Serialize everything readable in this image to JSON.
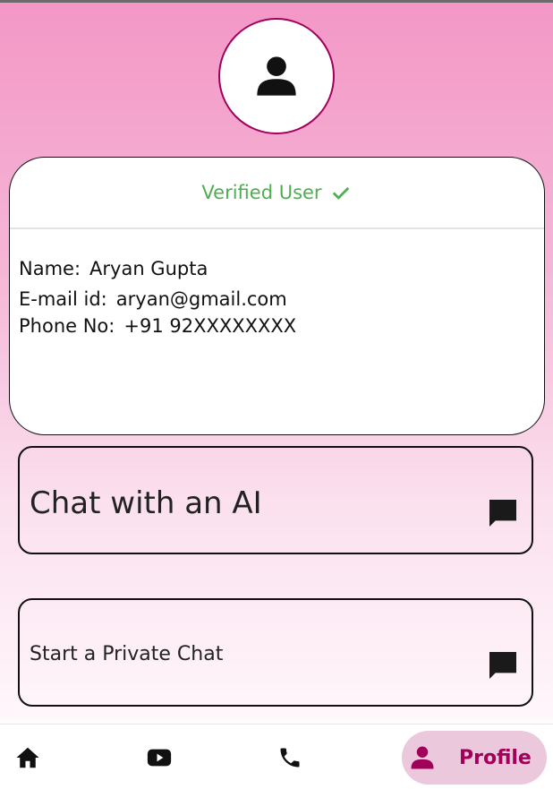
{
  "profile": {
    "avatar_icon": "person-icon",
    "verified_label": "Verified User",
    "verified_icon": "check-icon",
    "name_label": "Name:",
    "name_value": "Aryan Gupta",
    "email_label": "E-mail id:",
    "email_value": "aryan@gmail.com",
    "phone_label": "Phone No:",
    "phone_value": "+91 92XXXXXXXX"
  },
  "actions": {
    "ai_chat_label": "Chat with an AI",
    "private_chat_label": "Start a Private Chat",
    "chat_icon": "chat-bubble-icon"
  },
  "bottom_nav": {
    "items": [
      {
        "icon": "home-icon"
      },
      {
        "icon": "video-icon"
      },
      {
        "icon": "phone-icon"
      },
      {
        "icon": "person-icon",
        "label": "Profile",
        "active": true
      }
    ]
  },
  "colors": {
    "accent": "#a0005a",
    "verified": "#4caf50",
    "active_tab_bg": "#ebc8dc"
  }
}
